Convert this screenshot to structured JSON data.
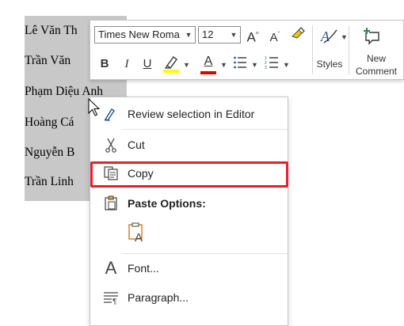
{
  "document": {
    "lines": [
      "Lê Văn Th",
      "Trần Văn",
      "Phạm Diệu Anh",
      "Hoàng Cá",
      "Nguyễn B",
      "Trần Linh"
    ]
  },
  "toolbar": {
    "font_name": "Times New Roma",
    "font_size": "12",
    "grow_font": "A",
    "shrink_font": "A",
    "bold": "B",
    "italic": "I",
    "underline": "U",
    "font_color": "A",
    "styles_label": "Styles",
    "new_comment_label_line1": "New",
    "new_comment_label_line2": "Comment",
    "colors": {
      "highlight": "#ffff00",
      "font_color": "#e00000"
    }
  },
  "context_menu": {
    "items": [
      {
        "label": "Review selection in Editor",
        "icon": "editor-pen-icon"
      },
      {
        "label": "Cut",
        "icon": "scissors-icon"
      },
      {
        "label": "Copy",
        "icon": "copy-icon"
      },
      {
        "label": "Paste Options:",
        "icon": "clipboard-icon"
      },
      {
        "label": "Font...",
        "icon": "font-icon"
      },
      {
        "label": "Paragraph...",
        "icon": "paragraph-icon"
      }
    ]
  },
  "colors": {
    "selection": "#c8c8c8",
    "highlight_border": "#e8202a",
    "accent_blue": "#2b579a",
    "new_comment_green": "#1e8a3c"
  }
}
